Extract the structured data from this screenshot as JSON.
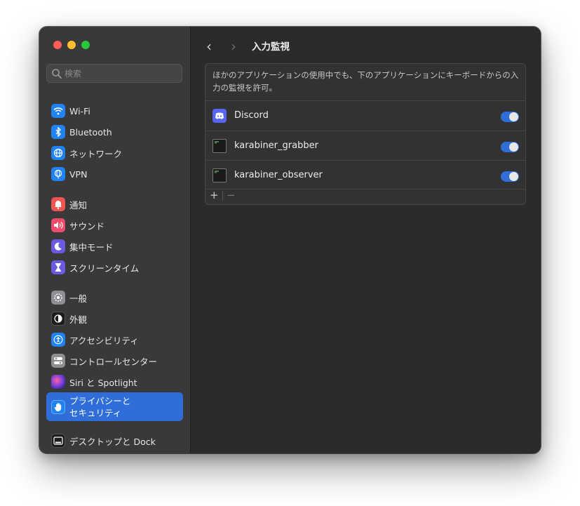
{
  "window": {
    "title": "入力監視"
  },
  "search": {
    "placeholder": "検索"
  },
  "sidebar": {
    "items": [
      {
        "label": "Wi-Fi",
        "icon": "wifi-icon",
        "color": "#1f83f5"
      },
      {
        "label": "Bluetooth",
        "icon": "bluetooth-icon",
        "color": "#1f83f5"
      },
      {
        "label": "ネットワーク",
        "icon": "globe-icon",
        "color": "#1f83f5"
      },
      {
        "label": "VPN",
        "icon": "globe-icon",
        "color": "#1f83f5"
      },
      {
        "label": "通知",
        "icon": "bell-icon",
        "color": "#f0554f"
      },
      {
        "label": "サウンド",
        "icon": "speaker-icon",
        "color": "#ee4c69"
      },
      {
        "label": "集中モード",
        "icon": "moon-icon",
        "color": "#6a5ae0"
      },
      {
        "label": "スクリーンタイム",
        "icon": "hourglass-icon",
        "color": "#6a5ae0"
      },
      {
        "label": "一般",
        "icon": "gear-icon",
        "color": "#8e8e93"
      },
      {
        "label": "外観",
        "icon": "appearance-icon",
        "color": "#1c1c1e"
      },
      {
        "label": "アクセシビリティ",
        "icon": "accessibility-icon",
        "color": "#1f83f5"
      },
      {
        "label": "コントロールセンター",
        "icon": "switches-icon",
        "color": "#8e8e93"
      },
      {
        "label": "Siri と Spotlight",
        "icon": "siri-icon",
        "color": "#b04bd8"
      },
      {
        "label": "プライバシーと\nセキュリティ",
        "icon": "hand-icon",
        "color": "#1f83f5",
        "selected": true
      },
      {
        "label": "デスクトップと Dock",
        "icon": "dock-icon",
        "color": "#1c1c1e"
      }
    ]
  },
  "main": {
    "description": "ほかのアプリケーションの使用中でも、下のアプリケーションにキーボードからの入力の監視を許可。",
    "apps": [
      {
        "name": "Discord",
        "icon": "discord-icon",
        "enabled": true
      },
      {
        "name": "karabiner_grabber",
        "icon": "terminal-icon",
        "enabled": true
      },
      {
        "name": "karabiner_observer",
        "icon": "terminal-icon",
        "enabled": true
      }
    ],
    "add_label": "+",
    "remove_label": "−"
  },
  "nav": {
    "back": "‹",
    "forward": "›"
  },
  "colors": {
    "accent": "#2f6ed8",
    "discord": "#5865f2"
  }
}
